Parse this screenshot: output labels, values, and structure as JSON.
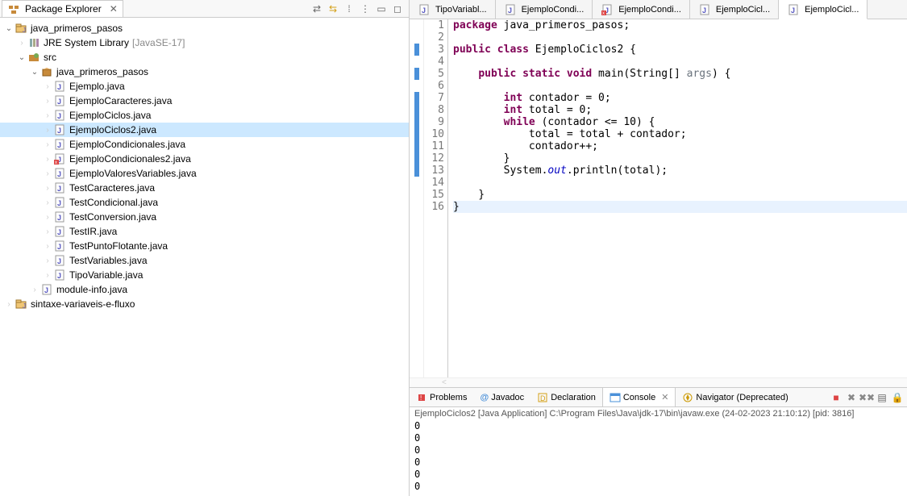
{
  "package_explorer": {
    "title": "Package Explorer",
    "projects": [
      {
        "name": "java_primeros_pasos",
        "type": "java-project",
        "expanded": true,
        "children": [
          {
            "name": "JRE System Library",
            "suffix": "[JavaSE-17]",
            "type": "library",
            "expanded": false
          },
          {
            "name": "src",
            "type": "src-folder",
            "expanded": true,
            "children": [
              {
                "name": "java_primeros_pasos",
                "type": "package",
                "expanded": true,
                "children": [
                  {
                    "name": "Ejemplo.java",
                    "type": "java-file"
                  },
                  {
                    "name": "EjemploCaracteres.java",
                    "type": "java-file"
                  },
                  {
                    "name": "EjemploCiclos.java",
                    "type": "java-file"
                  },
                  {
                    "name": "EjemploCiclos2.java",
                    "type": "java-file",
                    "selected": true
                  },
                  {
                    "name": "EjemploCondicionales.java",
                    "type": "java-file"
                  },
                  {
                    "name": "EjemploCondicionales2.java",
                    "type": "java-file-err"
                  },
                  {
                    "name": "EjemploValoresVariables.java",
                    "type": "java-file"
                  },
                  {
                    "name": "TestCaracteres.java",
                    "type": "java-file"
                  },
                  {
                    "name": "TestCondicional.java",
                    "type": "java-file"
                  },
                  {
                    "name": "TestConversion.java",
                    "type": "java-file"
                  },
                  {
                    "name": "TestIR.java",
                    "type": "java-file"
                  },
                  {
                    "name": "TestPuntoFlotante.java",
                    "type": "java-file"
                  },
                  {
                    "name": "TestVariables.java",
                    "type": "java-file"
                  },
                  {
                    "name": "TipoVariable.java",
                    "type": "java-file"
                  }
                ]
              },
              {
                "name": "module-info.java",
                "type": "java-file"
              }
            ]
          }
        ]
      },
      {
        "name": "sintaxe-variaveis-e-fluxo",
        "type": "java-project",
        "expanded": false
      }
    ]
  },
  "editor": {
    "tabs": [
      {
        "label": "TipoVariabl...",
        "icon": "java-file"
      },
      {
        "label": "EjemploCondi...",
        "icon": "java-file"
      },
      {
        "label": "EjemploCondi...",
        "icon": "java-file-err"
      },
      {
        "label": "EjemploCicl...",
        "icon": "java-file"
      },
      {
        "label": "EjemploCicl...",
        "icon": "java-file",
        "active": true
      }
    ],
    "code": {
      "lines": [
        {
          "n": 1,
          "html": "<span class='kw'>package</span> java_primeros_pasos;"
        },
        {
          "n": 2,
          "html": ""
        },
        {
          "n": 3,
          "html": "<span class='kw'>public</span> <span class='kw'>class</span> EjemploCiclos2 {"
        },
        {
          "n": 4,
          "html": ""
        },
        {
          "n": 5,
          "html": "    <span class='kw'>public</span> <span class='kw'>static</span> <span class='kw'>void</span> main(String[] <span class='arg-grey'>args</span>) {"
        },
        {
          "n": 6,
          "html": ""
        },
        {
          "n": 7,
          "html": "        <span class='kw'>int</span> contador = 0;"
        },
        {
          "n": 8,
          "html": "        <span class='kw'>int</span> total = 0;"
        },
        {
          "n": 9,
          "html": "        <span class='kw'>while</span> (contador &lt;= 10) {"
        },
        {
          "n": 10,
          "html": "            total = total + contador;"
        },
        {
          "n": 11,
          "html": "            contador++;"
        },
        {
          "n": 12,
          "html": "        }"
        },
        {
          "n": 13,
          "html": "        System.<span class='field'>out</span>.println(total);"
        },
        {
          "n": 14,
          "html": ""
        },
        {
          "n": 15,
          "html": "    }"
        },
        {
          "n": 16,
          "html": "}",
          "highlight": true
        }
      ],
      "ruler_marks": [
        3,
        5,
        7,
        8,
        9,
        10,
        11,
        12,
        13
      ]
    }
  },
  "bottom": {
    "tabs": [
      {
        "label": "Problems",
        "icon": "problems"
      },
      {
        "label": "Javadoc",
        "icon": "javadoc"
      },
      {
        "label": "Declaration",
        "icon": "declaration"
      },
      {
        "label": "Console",
        "icon": "console",
        "active": true,
        "closeable": true
      },
      {
        "label": "Navigator (Deprecated)",
        "icon": "navigator"
      }
    ],
    "console_header": "EjemploCiclos2 [Java Application] C:\\Program Files\\Java\\jdk-17\\bin\\javaw.exe  (24-02-2023 21:10:12) [pid: 3816]",
    "console_output": [
      "0",
      "0",
      "0",
      "0",
      "0",
      "0"
    ]
  }
}
